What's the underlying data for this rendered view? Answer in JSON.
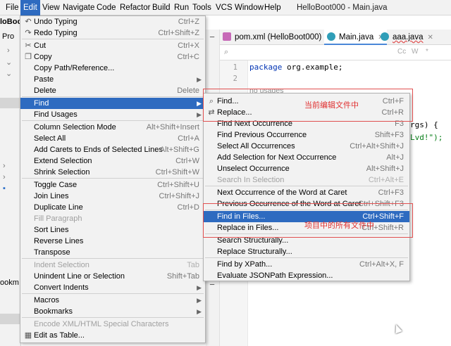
{
  "menubar": {
    "items": [
      "File",
      "Edit",
      "View",
      "Navigate",
      "Code",
      "Refactor",
      "Build",
      "Run",
      "Tools",
      "VCS",
      "Window",
      "Help"
    ],
    "window_title": "HelloBoot000 - Main.java"
  },
  "project_panel": {
    "root": "loBoot",
    "label": "Pro",
    "bottom_label": "ookm"
  },
  "tabs": [
    {
      "label": "pom.xml (HelloBoot000)",
      "icon": "maven-icon",
      "color": "#c76ab8"
    },
    {
      "label": "Main.java",
      "icon": "java-class-icon",
      "color": "#2f9eb8"
    },
    {
      "label": "aaa.java",
      "icon": "java-class-icon",
      "color": "#2f9eb8"
    }
  ],
  "search_options": [
    "Cc",
    "W",
    "*"
  ],
  "editor": {
    "line_numbers": [
      "1",
      "2"
    ],
    "package_kw": "package",
    "package_name": " org.example;",
    "usages": "no usages",
    "partial_args": "rgs) {",
    "partial_string": "Lvd!\");"
  },
  "edit_menu": {
    "items": [
      {
        "label": "Undo Typing",
        "shortcut": "Ctrl+Z",
        "icon": "undo-icon"
      },
      {
        "label": "Redo Typing",
        "shortcut": "Ctrl+Shift+Z",
        "icon": "redo-icon"
      },
      {
        "label": "Cut",
        "shortcut": "Ctrl+X",
        "icon": "scissors-icon"
      },
      {
        "label": "Copy",
        "shortcut": "Ctrl+C",
        "icon": "copy-icon"
      },
      {
        "label": "Copy Path/Reference...",
        "shortcut": ""
      },
      {
        "label": "Paste",
        "shortcut": "",
        "submenu": true
      },
      {
        "label": "Delete",
        "shortcut": "Delete"
      },
      {
        "label": "Find",
        "shortcut": "",
        "submenu": true,
        "highlighted": true
      },
      {
        "label": "Find Usages",
        "shortcut": "",
        "submenu": true
      },
      {
        "label": "Column Selection Mode",
        "shortcut": "Alt+Shift+Insert"
      },
      {
        "label": "Select All",
        "shortcut": "Ctrl+A"
      },
      {
        "label": "Add Carets to Ends of Selected Lines",
        "shortcut": "Alt+Shift+G"
      },
      {
        "label": "Extend Selection",
        "shortcut": "Ctrl+W"
      },
      {
        "label": "Shrink Selection",
        "shortcut": "Ctrl+Shift+W"
      },
      {
        "label": "Toggle Case",
        "shortcut": "Ctrl+Shift+U"
      },
      {
        "label": "Join Lines",
        "shortcut": "Ctrl+Shift+J"
      },
      {
        "label": "Duplicate Line",
        "shortcut": "Ctrl+D"
      },
      {
        "label": "Fill Paragraph",
        "shortcut": "",
        "disabled": true
      },
      {
        "label": "Sort Lines",
        "shortcut": ""
      },
      {
        "label": "Reverse Lines",
        "shortcut": ""
      },
      {
        "label": "Transpose",
        "shortcut": ""
      },
      {
        "label": "Indent Selection",
        "shortcut": "Tab",
        "disabled": true
      },
      {
        "label": "Unindent Line or Selection",
        "shortcut": "Shift+Tab"
      },
      {
        "label": "Convert Indents",
        "shortcut": "",
        "submenu": true
      },
      {
        "label": "Macros",
        "shortcut": "",
        "submenu": true
      },
      {
        "label": "Bookmarks",
        "shortcut": "",
        "submenu": true
      },
      {
        "label": "Encode XML/HTML Special Characters",
        "shortcut": "",
        "disabled": true
      },
      {
        "label": "Edit as Table...",
        "shortcut": "",
        "icon": "table-icon"
      }
    ]
  },
  "find_submenu": {
    "items": [
      {
        "label": "Find...",
        "shortcut": "Ctrl+F",
        "icon": "search-icon"
      },
      {
        "label": "Replace...",
        "shortcut": "Ctrl+R",
        "icon": "replace-icon"
      },
      {
        "label": "Find Next Occurrence",
        "shortcut": "F3"
      },
      {
        "label": "Find Previous Occurrence",
        "shortcut": "Shift+F3"
      },
      {
        "label": "Select All Occurrences",
        "shortcut": "Ctrl+Alt+Shift+J"
      },
      {
        "label": "Add Selection for Next Occurrence",
        "shortcut": "Alt+J"
      },
      {
        "label": "Unselect Occurrence",
        "shortcut": "Alt+Shift+J"
      },
      {
        "label": "Search In Selection",
        "shortcut": "Ctrl+Alt+E",
        "disabled": true
      },
      {
        "label": "Next Occurrence of the Word at Caret",
        "shortcut": "Ctrl+F3"
      },
      {
        "label": "Previous Occurrence of the Word at Caret",
        "shortcut": "Ctrl+Shift+F3"
      },
      {
        "label": "Find in Files...",
        "shortcut": "Ctrl+Shift+F",
        "highlighted": true
      },
      {
        "label": "Replace in Files...",
        "shortcut": "Ctrl+Shift+R"
      },
      {
        "label": "Search Structurally...",
        "shortcut": ""
      },
      {
        "label": "Replace Structurally...",
        "shortcut": ""
      },
      {
        "label": "Find by XPath...",
        "shortcut": "Ctrl+Alt+X, F"
      },
      {
        "label": "Evaluate JSONPath Expression...",
        "shortcut": ""
      }
    ]
  },
  "annotations": {
    "current_file": "当前编辑文件中",
    "project_files": "项目中的所有文件中"
  },
  "colors": {
    "highlight": "#2e6bc0",
    "annotation": "#e03030"
  }
}
